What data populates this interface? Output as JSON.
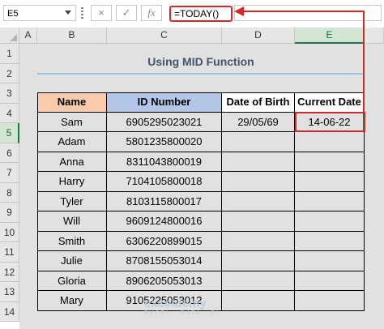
{
  "formula_bar": {
    "name_box": "E5",
    "cancel_icon": "×",
    "enter_icon": "✓",
    "fx_label": "fx",
    "formula": "=TODAY()"
  },
  "columns": [
    "A",
    "B",
    "C",
    "D",
    "E"
  ],
  "selected_column": "E",
  "rows": [
    "1",
    "2",
    "3",
    "4",
    "5",
    "6",
    "7",
    "8",
    "9",
    "10",
    "11",
    "12",
    "13",
    "14"
  ],
  "selected_row": "5",
  "title": "Using MID Function",
  "table": {
    "headers": [
      "Name",
      "ID Number",
      "Date of Birth",
      "Current Date"
    ],
    "rows": [
      [
        "Sam",
        "6905295023021",
        "29/05/69",
        "14-06-22"
      ],
      [
        "Adam",
        "5801235800020",
        "",
        ""
      ],
      [
        "Anna",
        "8311043800019",
        "",
        ""
      ],
      [
        "Harry",
        "7104105800018",
        "",
        ""
      ],
      [
        "Tyler",
        "8103115800017",
        "",
        ""
      ],
      [
        "Will",
        "9609124800016",
        "",
        ""
      ],
      [
        "Smith",
        "6306220899015",
        "",
        ""
      ],
      [
        "Julie",
        "8708155053014",
        "",
        ""
      ],
      [
        "Gloria",
        "8906205053013",
        "",
        ""
      ],
      [
        "Mary",
        "9105225053012",
        "",
        ""
      ]
    ]
  },
  "colors": {
    "accent_red": "#d12a2a",
    "excel_green": "#217346",
    "name_header_bg": "#f8cbad",
    "id_header_bg": "#b4c6e7"
  },
  "watermark": {
    "brand": "exceldemy",
    "tagline": "EXCEL · DATA · BI"
  }
}
